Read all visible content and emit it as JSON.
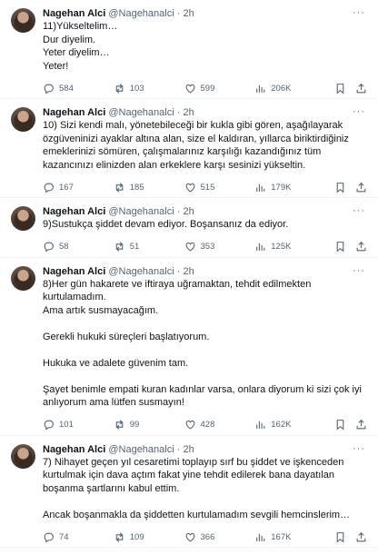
{
  "tweets": [
    {
      "name": "Nagehan Alci",
      "handle": "@Nagehanalci",
      "dot": "·",
      "time": "2h",
      "text": "11)Yükseltelim…\nDur diyelim.\nYeter diyelim…\nYeter!",
      "replies": "584",
      "retweets": "103",
      "likes": "599",
      "views": "206K"
    },
    {
      "name": "Nagehan Alci",
      "handle": "@Nagehanalci",
      "dot": "·",
      "time": "2h",
      "text": "10) Sizi kendi malı, yönetebileceği bir kukla gibi gören, aşağılayarak özgüveninizi ayaklar altına alan, size el kaldıran, yıllarca biriktirdiğiniz emeklerinizi sömüren, çalışmalarınız karşılığı kazandığınız tüm kazancınızı elinizden alan erkeklere karşı sesinizi yükseltin.",
      "replies": "167",
      "retweets": "185",
      "likes": "515",
      "views": "179K"
    },
    {
      "name": "Nagehan Alci",
      "handle": "@Nagehanalci",
      "dot": "·",
      "time": "2h",
      "text": "9)Sustukça şiddet devam ediyor. Boşansanız da ediyor.",
      "replies": "58",
      "retweets": "51",
      "likes": "353",
      "views": "125K"
    },
    {
      "name": "Nagehan Alci",
      "handle": "@Nagehanalci",
      "dot": "·",
      "time": "2h",
      "text": "8)Her gün hakarete ve iftiraya uğramaktan, tehdit edilmekten kurtulamadım.\nAma artık susmayacağım.\n\nGerekli hukuki süreçleri başlatıyorum.\n\nHukuka ve adalete güvenim tam.\n\nŞayet benimle empati kuran kadınlar varsa, onlara diyorum ki sizi çok iyi anlıyorum ama lütfen susmayın!",
      "replies": "101",
      "retweets": "99",
      "likes": "428",
      "views": "162K"
    },
    {
      "name": "Nagehan Alci",
      "handle": "@Nagehanalci",
      "dot": "·",
      "time": "2h",
      "text": "7) Nihayet geçen yıl cesaretimi toplayıp sırf bu şiddet ve işkenceden kurtulmak için dava açtım fakat yine tehdit edilerek bana dayatılan boşanma şartlarını kabul ettim.\n\nAncak boşanmakla da şiddetten kurtulamadım sevgili  hemcinslerim…",
      "replies": "74",
      "retweets": "109",
      "likes": "366",
      "views": "167K"
    }
  ],
  "icons": {
    "reply": "reply-icon",
    "retweet": "retweet-icon",
    "like": "heart-icon",
    "views": "views-icon",
    "bookmark": "bookmark-icon",
    "share": "share-icon",
    "more": "more-icon"
  },
  "colors": {
    "text": "#0f1419",
    "secondary": "#536471",
    "divider": "#eff3f4"
  }
}
